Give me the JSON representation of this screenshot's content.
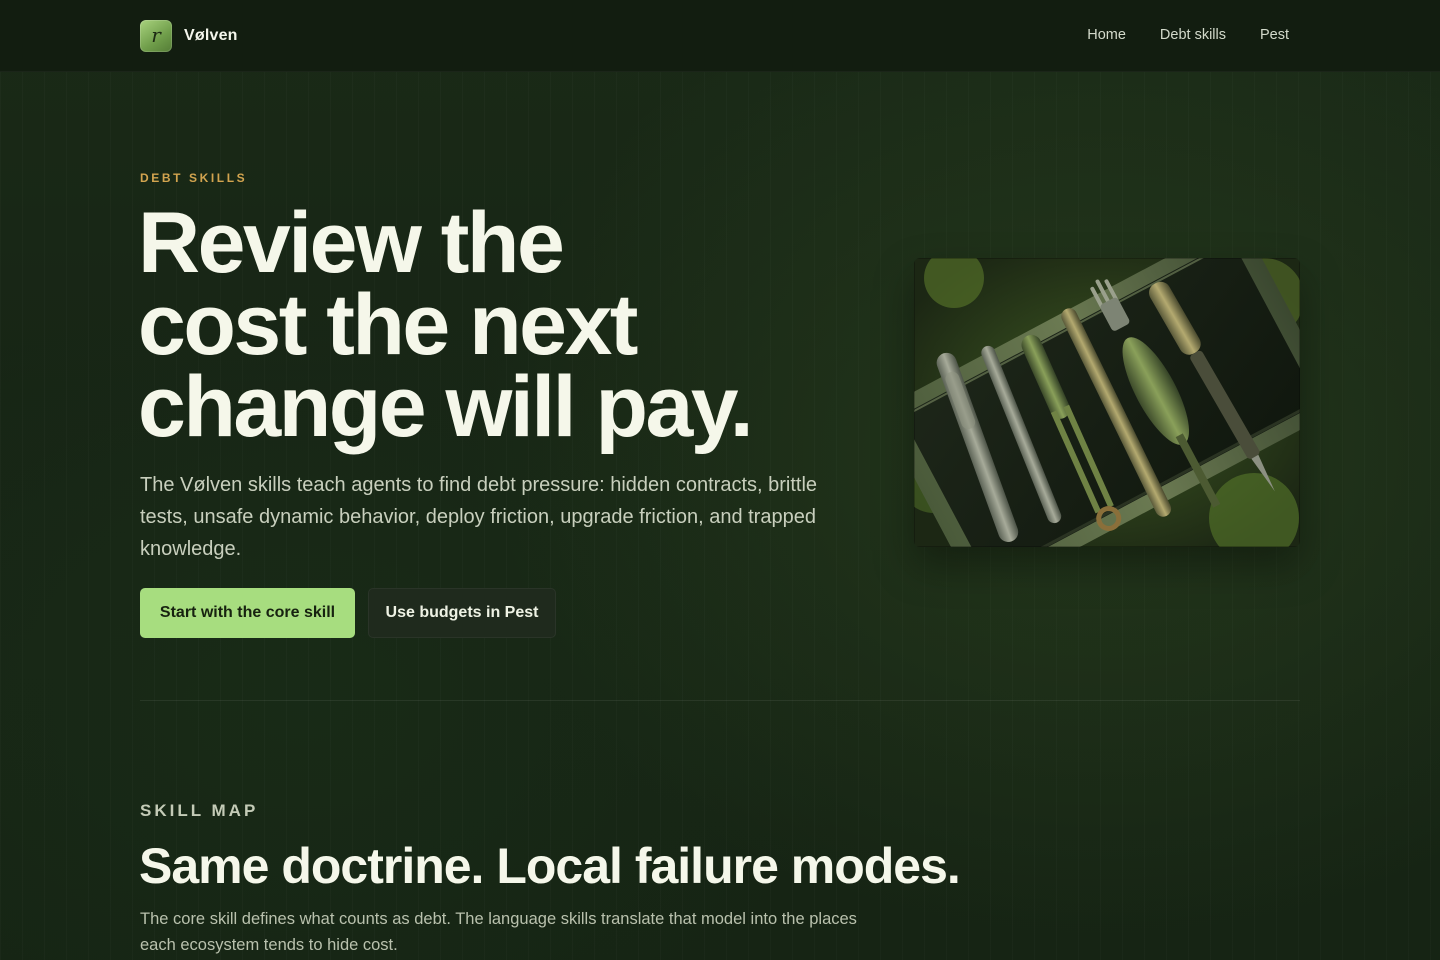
{
  "header": {
    "brand_name": "Vølven",
    "logo_glyph": "r",
    "nav": [
      {
        "label": "Home"
      },
      {
        "label": "Debt skills"
      },
      {
        "label": "Pest"
      }
    ]
  },
  "hero": {
    "eyebrow": "DEBT SKILLS",
    "title_lines": [
      "Review the",
      "cost the next",
      "change will pay."
    ],
    "description": "The Vølven skills teach agents to find debt pressure: hidden contracts, brittle tests, unsafe dynamic behavior, deploy friction, upgrade friction, and trapped knowledge.",
    "primary_button": "Start with the core skill",
    "secondary_button": "Use budgets in Pest",
    "image_subject": "wooden-tools-in-mossy-tray-image"
  },
  "skill_map": {
    "eyebrow": "SKILL MAP",
    "title": "Same doctrine. Local failure modes.",
    "description": "The core skill defines what counts as debt. The language skills translate that model into the places each ecosystem tends to hide cost."
  },
  "colors": {
    "accent_green": "#a7dd7f",
    "eyebrow_gold": "#d2a44f",
    "background": "#172515"
  }
}
